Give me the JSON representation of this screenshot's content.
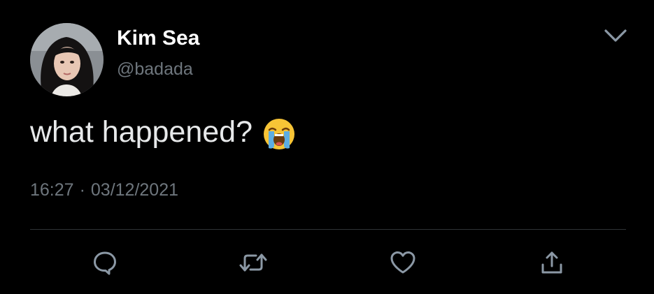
{
  "user": {
    "display_name": "Kim Sea",
    "handle": "@badada",
    "avatar_icon": "profile-photo"
  },
  "tweet": {
    "text": "what happened?",
    "emoji": "loudly-crying-face",
    "time": "16:27",
    "separator": "·",
    "date": "03/12/2021"
  },
  "actions": {
    "reply_icon": "reply-icon",
    "retweet_icon": "retweet-icon",
    "like_icon": "heart-icon",
    "share_icon": "share-icon"
  },
  "colors": {
    "background": "#000000",
    "primary_text": "#e7e9ea",
    "secondary_text": "#6e767d",
    "icon": "#8b98a5",
    "divider": "#2f3336"
  }
}
